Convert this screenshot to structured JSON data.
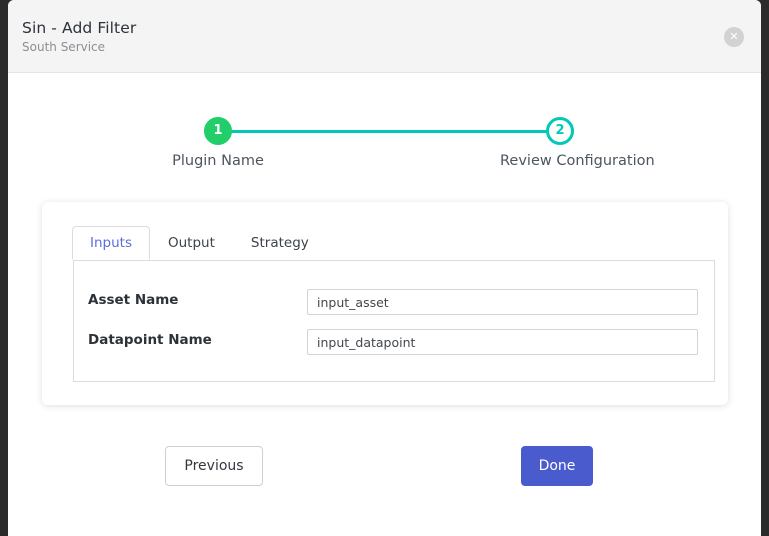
{
  "header": {
    "title": "Sin - Add Filter",
    "subtitle": "South Service",
    "close_icon": "close-icon",
    "close_glyph": "✕"
  },
  "stepper": {
    "steps": [
      {
        "number": "1",
        "label": "Plugin Name",
        "state": "done"
      },
      {
        "number": "2",
        "label": "Review Configuration",
        "state": "current"
      }
    ],
    "done_color": "#21ce6a",
    "current_color": "#00c9b7",
    "line_color": "#00c9b7"
  },
  "card": {
    "tabs": [
      {
        "label": "Inputs",
        "active": true
      },
      {
        "label": "Output",
        "active": false
      },
      {
        "label": "Strategy",
        "active": false
      }
    ],
    "active_tab_color": "#5b6ce0",
    "fields": [
      {
        "label": "Asset Name",
        "value": "input_asset",
        "placeholder": ""
      },
      {
        "label": "Datapoint Name",
        "value": "input_datapoint",
        "placeholder": ""
      }
    ]
  },
  "footer": {
    "previous_label": "Previous",
    "done_label": "Done",
    "done_color": "#4a5ccd"
  }
}
